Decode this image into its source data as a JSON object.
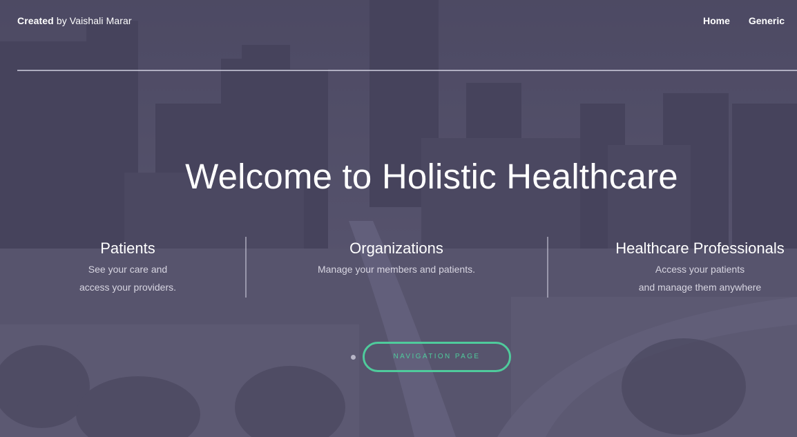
{
  "header": {
    "brand_strong": "Created",
    "brand_rest": " by Vaishali Marar",
    "nav": [
      {
        "label": "Home"
      },
      {
        "label": "Generic"
      }
    ]
  },
  "hero": {
    "title": "Welcome to Holistic Healthcare"
  },
  "features": [
    {
      "title": "Patients",
      "desc_line1": "See your care and",
      "desc_line2": "access your providers."
    },
    {
      "title": "Organizations",
      "desc_line1": "Manage your members and patients.",
      "desc_line2": ""
    },
    {
      "title": "Healthcare Professionals",
      "desc_line1": "Access your patients",
      "desc_line2": "and manage them anywhere"
    }
  ],
  "cta": {
    "label": "NAVIGATION PAGE"
  },
  "colors": {
    "accent": "#4fcb9c",
    "overlay": "#55536a",
    "text": "#ffffff"
  }
}
